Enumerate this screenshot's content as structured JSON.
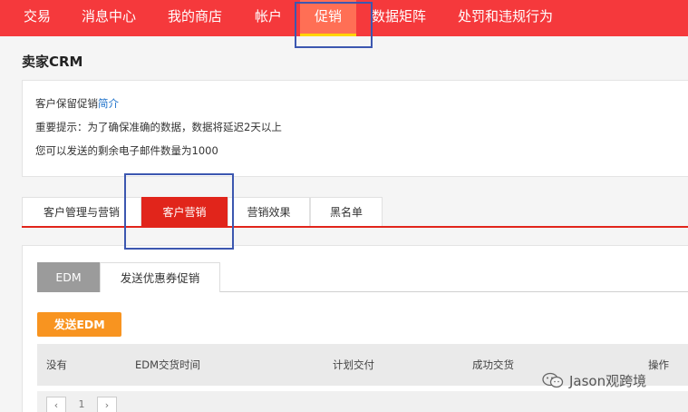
{
  "topnav": {
    "items": [
      {
        "label": "交易"
      },
      {
        "label": "消息中心"
      },
      {
        "label": "我的商店"
      },
      {
        "label": "帐户"
      },
      {
        "label": "促销"
      },
      {
        "label": "数据矩阵"
      },
      {
        "label": "处罚和违规行为"
      }
    ],
    "active_index": 4
  },
  "page_title": "卖家CRM",
  "info": {
    "line1_text": "客户保留促销",
    "line1_link": "简介",
    "line2": "重要提示：为了确保准确的数据，数据将延迟2天以上",
    "line3": "您可以发送的剩余电子邮件数量为1000"
  },
  "tabs": [
    {
      "label": "客户管理与营销"
    },
    {
      "label": "客户营销"
    },
    {
      "label": "营销效果"
    },
    {
      "label": "黑名单"
    }
  ],
  "active_tab": 1,
  "subtabs": [
    {
      "label": "EDM"
    },
    {
      "label": "发送优惠券促销"
    }
  ],
  "send_button": "发送EDM",
  "table": {
    "columns": [
      "没有",
      "EDM交货时间",
      "计划交付",
      "成功交货",
      "操作"
    ]
  },
  "pager": {
    "prev": "‹",
    "page": "1",
    "next": "›"
  },
  "watermark": "Jason观跨境",
  "colors": {
    "nav_red": "#f5393c",
    "tab_red": "#e1251b",
    "button_orange": "#f89420",
    "highlight_blue": "#3c57b0"
  }
}
